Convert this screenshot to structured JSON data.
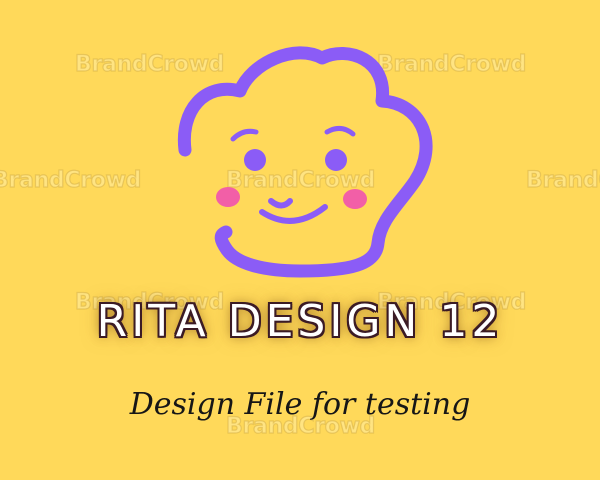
{
  "watermark": {
    "text": "BrandCrowd"
  },
  "brand": {
    "title": "RITA DESIGN 12",
    "tagline": "Design File for testing"
  },
  "colors": {
    "background": "#ffd95a",
    "logo_outline": "#8b5cf6",
    "cheeks": "#f25fa7",
    "title_outline": "#3b1b25",
    "tagline": "#161616"
  },
  "icons": {
    "logo": "smiling-cloud-face-icon"
  }
}
